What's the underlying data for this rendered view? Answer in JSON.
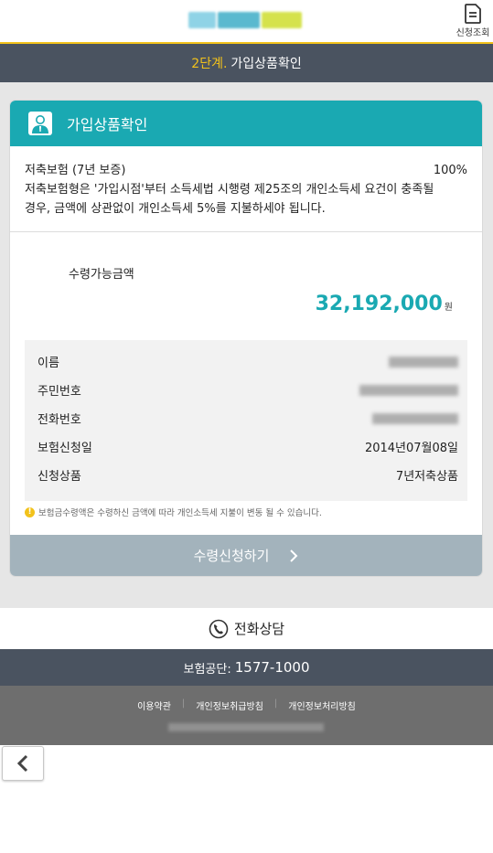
{
  "header": {
    "inquiry_label": "신청조회",
    "inquiry_icon": "document-icon"
  },
  "step": {
    "number": "2단계.",
    "title": "가입상품확인"
  },
  "card": {
    "title": "가입상품확인",
    "icon": "person-icon",
    "product_name": "저축보험 (7년 보증)",
    "percent": "100%",
    "notice_line1": "저축보험형은 '가입시점'부터 소득세법 시행령 제25조의 개인소득세 요건이 충족될",
    "notice_line2": "경우, 금액에 상관없이 개인소득세 5%를 지불하세야 됩니다.",
    "amount_label": "수령가능금액",
    "amount_value": "32,192,000",
    "amount_unit": "원",
    "info_rows": [
      {
        "label": "이름",
        "value": ""
      },
      {
        "label": "주민번호",
        "value": ""
      },
      {
        "label": "전화번호",
        "value": ""
      },
      {
        "label": "보험신청일",
        "value": "2014년07월08일"
      },
      {
        "label": "신청상품",
        "value": "7년저축상품"
      }
    ],
    "warning": "보험금수령액은 수령하신 금액에 따라 개인소득세 지불이 변동 될 수 있습니다.",
    "apply_button": "수령신청하기"
  },
  "phone_consult": "전화상담",
  "call_center": {
    "label": "보험공단:",
    "number": "1577-1000"
  },
  "footer": {
    "links": [
      "이용약관",
      "개인정보취급방침",
      "개인정보처리방침"
    ]
  },
  "colors": {
    "accent": "#1aa9b2",
    "step_highlight": "#f2c21b",
    "dark_bar": "#4a5360",
    "button_disabled": "#a3b3bc"
  }
}
